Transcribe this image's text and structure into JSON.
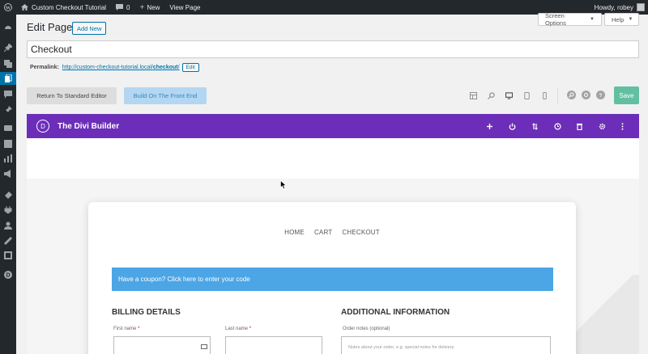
{
  "admin_bar": {
    "site_name": "Custom Checkout Tutorial",
    "comments_count": "0",
    "new_label": "New",
    "view_page_label": "View Page",
    "howdy_label": "Howdy, robey"
  },
  "screen_options_label": "Screen Options",
  "help_label": "Help",
  "page": {
    "heading": "Edit Page",
    "add_new_label": "Add New",
    "title_value": "Checkout",
    "permalink_label": "Permalink:",
    "permalink_base": "http://custom-checkout-tutorial.local/",
    "permalink_slug": "checkout",
    "permalink_trail": "/",
    "permalink_edit_label": "Edit"
  },
  "editor_buttons": {
    "standard_editor": "Return To Standard Editor",
    "front_end": "Build On The Front End",
    "save": "Save"
  },
  "divi": {
    "logo_letter": "D",
    "title": "The Divi Builder"
  },
  "preview": {
    "menu": [
      "Home",
      "Cart",
      "Checkout"
    ],
    "coupon_text": "Have a coupon? Click here to enter your code",
    "billing_title": "BILLING DETAILS",
    "additional_title": "ADDITIONAL INFORMATION",
    "first_name_label": "First name",
    "last_name_label": "Last name",
    "required_mark": "*",
    "order_notes_label": "Order notes (optional)",
    "order_notes_placeholder": "Notes about your order, e.g. special notes for delivery."
  },
  "colors": {
    "admin_bar": "#23282d",
    "divi_purple": "#6c2eb9",
    "save_green": "#63bfa2",
    "coupon_blue": "#4ca5e5",
    "wp_blue": "#0073aa"
  }
}
